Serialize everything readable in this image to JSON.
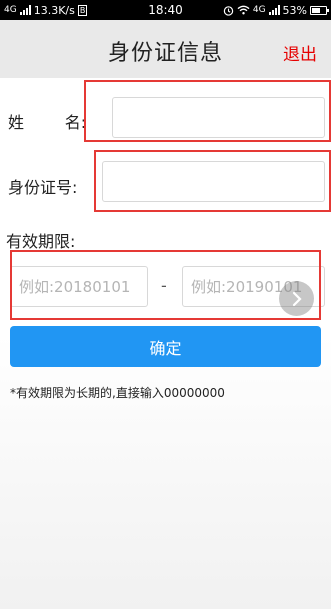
{
  "status_bar": {
    "network": "4G",
    "speed": "13.3K/s",
    "sim_badge": "B",
    "time": "18:40",
    "network_right": "4G",
    "battery": "53%"
  },
  "header": {
    "title": "身份证信息",
    "logout_label": "退出"
  },
  "form": {
    "name_label": "姓        名:",
    "name_value": "",
    "id_label": "身份证号:",
    "id_value": "",
    "validity_label": "有效期限:",
    "start_placeholder": "例如:20180101",
    "end_placeholder": "例如:20190101",
    "separator": "-"
  },
  "confirm_label": "确定",
  "hint": "*有效期限为长期的,直接输入00000000",
  "colors": {
    "accent": "#2196f3",
    "logout": "#e60000",
    "annotation": "#e53935"
  },
  "icons": {
    "alarm": "alarm-icon",
    "wifi": "wifi-icon",
    "signal": "signal-icon",
    "battery": "battery-icon",
    "next": "chevron-right-icon"
  }
}
